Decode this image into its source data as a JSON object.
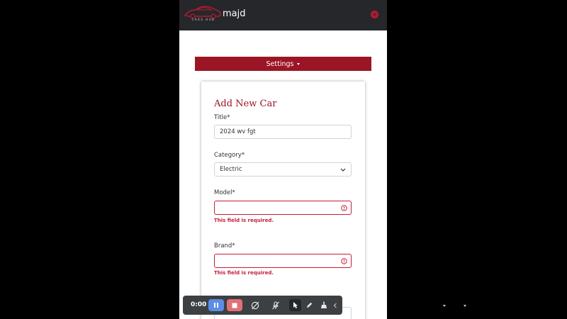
{
  "navbar": {
    "logo_text": "CARS HUB",
    "user_name": "majd",
    "toggle_icon": "chevron-down-circle-icon"
  },
  "settings": {
    "label": "Settings",
    "icon": "caret-down-icon"
  },
  "form": {
    "title": "Add New Car",
    "fields": {
      "title": {
        "label": "Title*",
        "value": "2024 wv fgt"
      },
      "category": {
        "label": "Category*",
        "value": "Electric"
      },
      "model": {
        "label": "Model*",
        "value": "",
        "error": "This field is required."
      },
      "brand": {
        "label": "Brand*",
        "value": "",
        "error": "This field is required."
      }
    }
  },
  "recorder": {
    "time": "0:00",
    "buttons": [
      "pause-icon",
      "stop-icon",
      "camera-off-icon",
      "mic-off-icon",
      "pointer-icon",
      "pen-icon",
      "broom-icon",
      "collapse-icon"
    ]
  },
  "colors": {
    "brand_red": "#9b1525",
    "error_red": "#c41e3a",
    "navbar_bg": "#26272b",
    "pause_blue": "#5b8de6",
    "stop_red": "#e27077"
  }
}
